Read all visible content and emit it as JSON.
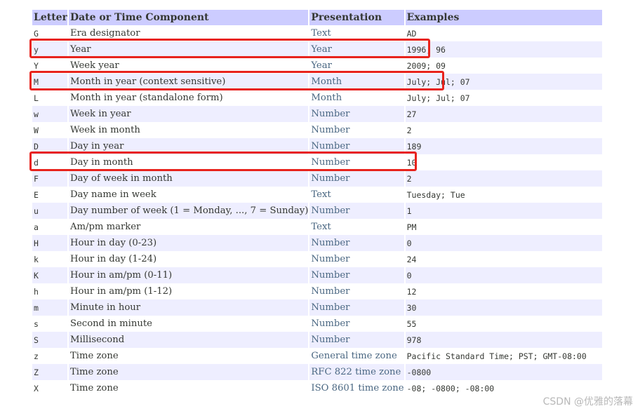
{
  "table": {
    "headers": [
      "Letter",
      "Date or Time Component",
      "Presentation",
      "Examples"
    ],
    "rows": [
      {
        "letter": "G",
        "component": "Era designator",
        "presentation": "Text",
        "examples": "AD",
        "highlighted": false
      },
      {
        "letter": "y",
        "component": "Year",
        "presentation": "Year",
        "examples": "1996; 96",
        "highlighted": true
      },
      {
        "letter": "Y",
        "component": "Week year",
        "presentation": "Year",
        "examples": "2009; 09",
        "highlighted": false
      },
      {
        "letter": "M",
        "component": "Month in year (context sensitive)",
        "presentation": "Month",
        "examples": "July; Jul; 07",
        "highlighted": true
      },
      {
        "letter": "L",
        "component": "Month in year (standalone form)",
        "presentation": "Month",
        "examples": "July; Jul; 07",
        "highlighted": false
      },
      {
        "letter": "w",
        "component": "Week in year",
        "presentation": "Number",
        "examples": "27",
        "highlighted": false
      },
      {
        "letter": "W",
        "component": "Week in month",
        "presentation": "Number",
        "examples": "2",
        "highlighted": false
      },
      {
        "letter": "D",
        "component": "Day in year",
        "presentation": "Number",
        "examples": "189",
        "highlighted": false
      },
      {
        "letter": "d",
        "component": "Day in month",
        "presentation": "Number",
        "examples": "10",
        "highlighted": true
      },
      {
        "letter": "F",
        "component": "Day of week in month",
        "presentation": "Number",
        "examples": "2",
        "highlighted": false
      },
      {
        "letter": "E",
        "component": "Day name in week",
        "presentation": "Text",
        "examples": "Tuesday; Tue",
        "highlighted": false
      },
      {
        "letter": "u",
        "component": "Day number of week (1 = Monday, ..., 7 = Sunday)",
        "presentation": "Number",
        "examples": "1",
        "highlighted": false
      },
      {
        "letter": "a",
        "component": "Am/pm marker",
        "presentation": "Text",
        "examples": "PM",
        "highlighted": false
      },
      {
        "letter": "H",
        "component": "Hour in day (0-23)",
        "presentation": "Number",
        "examples": "0",
        "highlighted": false
      },
      {
        "letter": "k",
        "component": "Hour in day (1-24)",
        "presentation": "Number",
        "examples": "24",
        "highlighted": false
      },
      {
        "letter": "K",
        "component": "Hour in am/pm (0-11)",
        "presentation": "Number",
        "examples": "0",
        "highlighted": false
      },
      {
        "letter": "h",
        "component": "Hour in am/pm (1-12)",
        "presentation": "Number",
        "examples": "12",
        "highlighted": false
      },
      {
        "letter": "m",
        "component": "Minute in hour",
        "presentation": "Number",
        "examples": "30",
        "highlighted": false
      },
      {
        "letter": "s",
        "component": "Second in minute",
        "presentation": "Number",
        "examples": "55",
        "highlighted": false
      },
      {
        "letter": "S",
        "component": "Millisecond",
        "presentation": "Number",
        "examples": "978",
        "highlighted": false
      },
      {
        "letter": "z",
        "component": "Time zone",
        "presentation": "General time zone",
        "examples": "Pacific Standard Time; PST; GMT-08:00",
        "highlighted": false
      },
      {
        "letter": "Z",
        "component": "Time zone",
        "presentation": "RFC 822 time zone",
        "examples": "-0800",
        "highlighted": false
      },
      {
        "letter": "X",
        "component": "Time zone",
        "presentation": "ISO 8601 time zone",
        "examples": "-08; -0800; -08:00",
        "highlighted": false
      }
    ]
  },
  "watermark": "CSDN @优雅的落幕",
  "colors": {
    "header_bg": "#ccccff",
    "alt_row_bg": "#eeeeff",
    "highlight_border": "#e8231d",
    "presentation_text": "#4a6782"
  }
}
